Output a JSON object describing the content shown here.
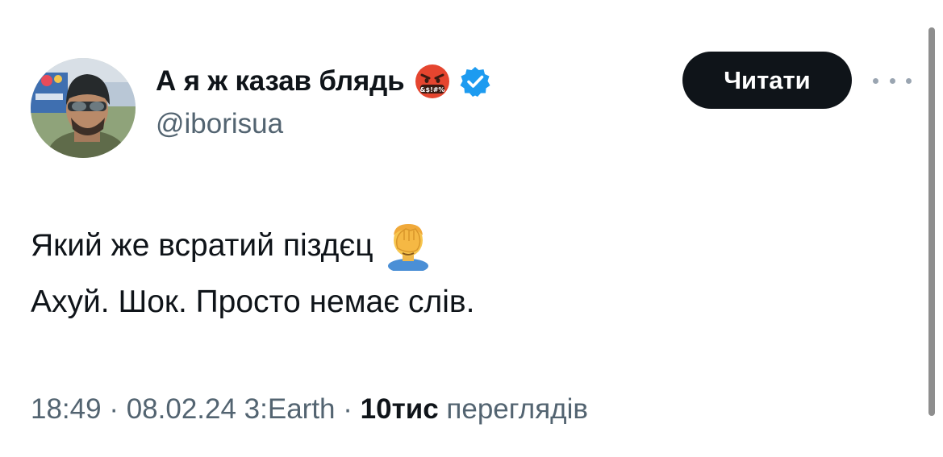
{
  "author": {
    "display_name": "А я ж казав блядь",
    "handle": "@iborisua",
    "name_emoji": "angry-face-with-symbols-icon",
    "verified": true
  },
  "follow_button": {
    "label": "Читати"
  },
  "more_button": {
    "icon": "more-dots-icon"
  },
  "tweet": {
    "line1": "Який же всратий піздєц",
    "line1_emoji": "facepalm-icon",
    "line2": "Ахуй. Шок. Просто немає слів."
  },
  "meta": {
    "time": "18:49",
    "sep1": " · ",
    "date": "08.02.24",
    "source": " 3:Earth",
    "sep2": " · ",
    "views_count": "10тис",
    "views_label": " переглядів"
  },
  "colors": {
    "text_primary": "#0f1419",
    "text_secondary": "#536471",
    "verified_blue": "#1d9bf0",
    "button_bg": "#0f1419"
  }
}
